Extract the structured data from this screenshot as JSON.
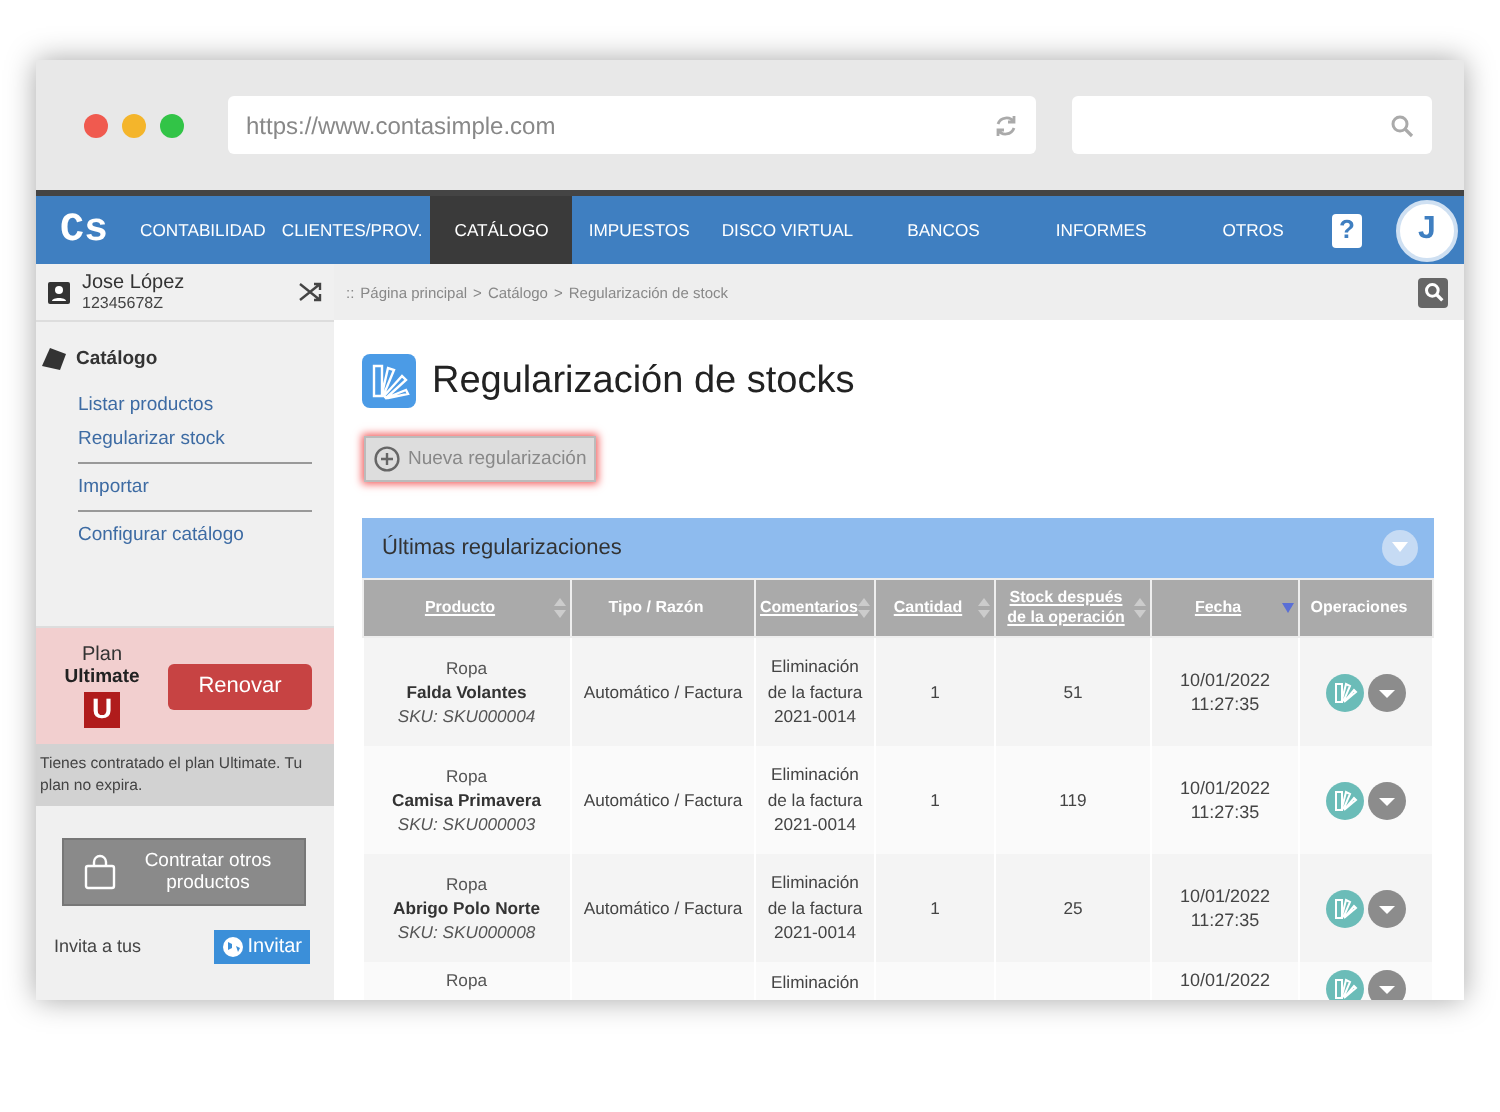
{
  "browser": {
    "url": "https://www.contasimple.com"
  },
  "nav": {
    "logo": "Cs",
    "items": [
      {
        "label": "CONTABILIDAD",
        "selected": false
      },
      {
        "label": "CLIENTES/PROV.",
        "selected": false
      },
      {
        "label": "CATÁLOGO",
        "selected": true
      },
      {
        "label": "IMPUESTOS",
        "selected": false
      },
      {
        "label": "DISCO VIRTUAL",
        "selected": false
      },
      {
        "label": "BANCOS",
        "selected": false
      },
      {
        "label": "INFORMES",
        "selected": false
      },
      {
        "label": "OTROS",
        "selected": false
      }
    ],
    "help": "?",
    "avatar": "J"
  },
  "user": {
    "name": "Jose López",
    "id": "12345678Z"
  },
  "sidebar": {
    "section": "Catálogo",
    "groups": [
      [
        "Listar productos",
        "Regularizar stock"
      ],
      [
        "Importar"
      ],
      [
        "Configurar catálogo"
      ]
    ]
  },
  "plan": {
    "label": "Plan",
    "name": "Ultimate",
    "badge": "U",
    "renew": "Renovar",
    "note": "Tienes contratado el plan Ultimate. Tu plan no expira."
  },
  "contract_button": "Contratar otros productos",
  "invite": {
    "text": "Invita a tus",
    "button": "Invitar"
  },
  "breadcrumb": {
    "prefix": "::",
    "separator": ">",
    "links": [
      "Página principal",
      "Catálogo"
    ],
    "current": "Regularización de stock"
  },
  "title": "Regularización de stocks",
  "new_button": "Nueva regularización",
  "panel_title": "Últimas regularizaciones",
  "columns": [
    {
      "label": "Producto",
      "sortable": true,
      "sorted": false
    },
    {
      "label": "Tipo / Razón",
      "sortable": false,
      "sorted": false
    },
    {
      "label": "Comentarios",
      "sortable": true,
      "sorted": false
    },
    {
      "label": "Cantidad",
      "sortable": true,
      "sorted": false
    },
    {
      "label": "Stock después de la operación",
      "sortable": true,
      "sorted": false
    },
    {
      "label": "Fecha",
      "sortable": true,
      "sorted": true
    },
    {
      "label": "Operaciones",
      "sortable": false,
      "sorted": false
    }
  ],
  "rows": [
    {
      "category": "Ropa",
      "name": "Falda Volantes",
      "sku": "SKU: SKU000004",
      "type": "Automático / Factura",
      "comment": "Eliminación de la factura 2021-0014",
      "quantity": "1",
      "stock": "51",
      "date": "10/01/2022",
      "time": "11:27:35"
    },
    {
      "category": "Ropa",
      "name": "Camisa Primavera",
      "sku": "SKU: SKU000003",
      "type": "Automático / Factura",
      "comment": "Eliminación de la factura 2021-0014",
      "quantity": "1",
      "stock": "119",
      "date": "10/01/2022",
      "time": "11:27:35"
    },
    {
      "category": "Ropa",
      "name": "Abrigo Polo Norte",
      "sku": "SKU: SKU000008",
      "type": "Automático / Factura",
      "comment": "Eliminación de la factura 2021-0014",
      "quantity": "1",
      "stock": "25",
      "date": "10/01/2022",
      "time": "11:27:35"
    },
    {
      "category": "Ropa",
      "comment": "Eliminación",
      "date": "10/01/2022"
    }
  ]
}
